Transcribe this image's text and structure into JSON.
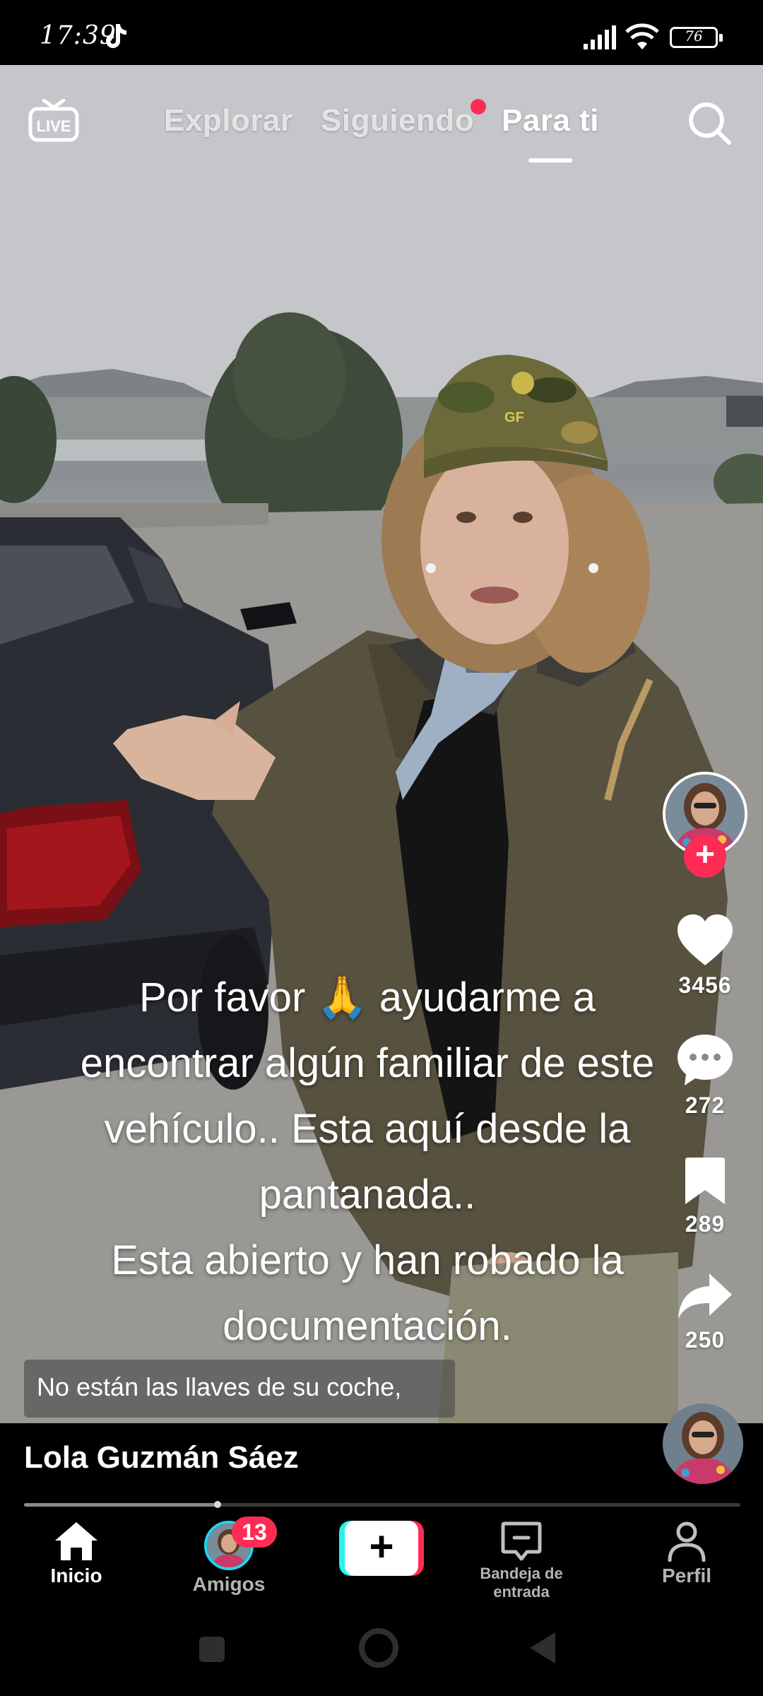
{
  "status_bar": {
    "time": "17:39",
    "battery": "76",
    "icons": [
      "tiktok-icon",
      "signal-icon",
      "wifi-icon",
      "battery-icon"
    ]
  },
  "top_nav": {
    "live_label": "LIVE",
    "tabs": [
      {
        "label": "Explorar",
        "active": false
      },
      {
        "label": "Siguiendo",
        "active": false,
        "dot": true
      },
      {
        "label": "Para ti",
        "active": true
      }
    ]
  },
  "video": {
    "overlay_lines": [
      "Por favor 🙏 ayudarme a",
      "encontrar algún familiar de este",
      "vehículo.. Esta aquí desde la",
      "pantanada..",
      "Esta abierto y han robado la",
      "documentación."
    ],
    "subtitle": "No están las llaves de su coche,",
    "cap_logo": "GF"
  },
  "actions": {
    "likes": "3456",
    "comments": "272",
    "saves": "289",
    "shares": "250",
    "follow_symbol": "+"
  },
  "author": {
    "name": "Lola Guzmán Sáez"
  },
  "progress": {
    "played_fraction": 0.27
  },
  "bottom_nav": {
    "items": [
      {
        "label": "Inicio",
        "active": true
      },
      {
        "label": "Amigos",
        "badge": "13"
      },
      {
        "label": "+"
      },
      {
        "label": "Bandeja de entrada"
      },
      {
        "label": "Perfil"
      }
    ]
  },
  "colors": {
    "accent": "#fe2c55",
    "cyan": "#25f4ee",
    "background": "#000000"
  }
}
